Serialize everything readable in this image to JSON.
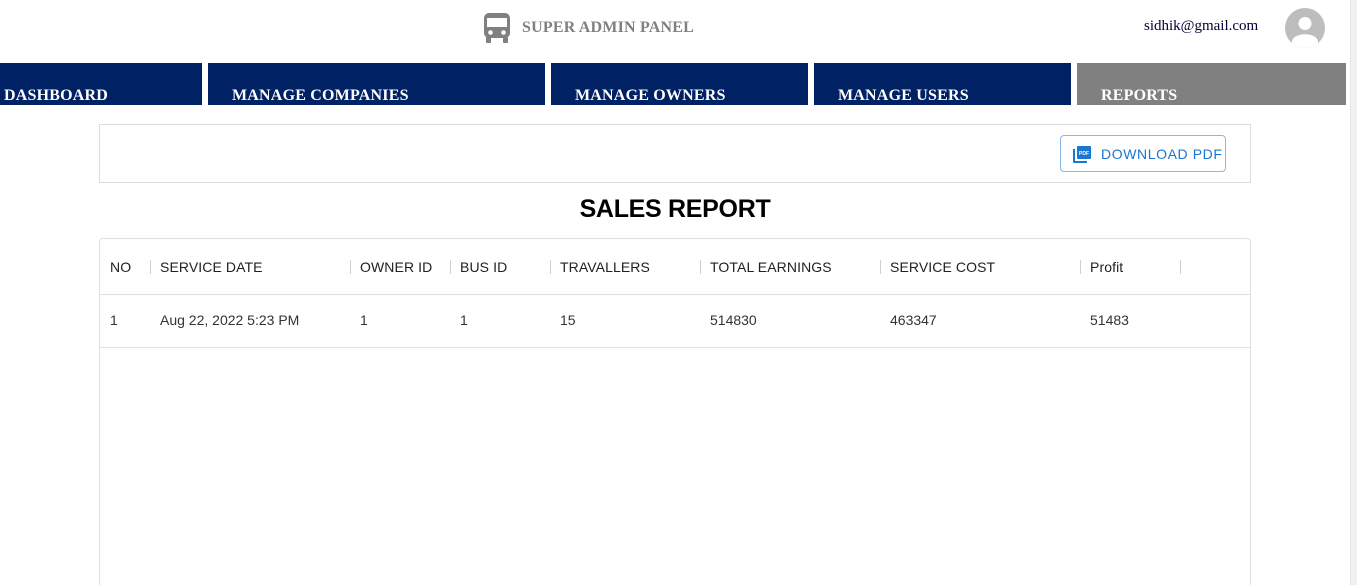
{
  "header": {
    "brand_icon": "bus-icon",
    "title": "SUPER ADMIN PANEL",
    "user_email": "sidhik@gmail.com",
    "avatar_icon": "account-circle-icon"
  },
  "nav": {
    "dashboard": "DASHBOARD",
    "companies": "MANAGE COMPANIES",
    "owners": "MANAGE OWNERS",
    "users": "MANAGE USERS",
    "reports": "REPORTS",
    "active": "REPORTS",
    "colors": {
      "nav_bg": "#002164",
      "active_bg": "#808080"
    }
  },
  "toolbar": {
    "download_label": "DOWNLOAD PDF",
    "download_icon": "picture-as-pdf-icon",
    "accent": "#1976d2"
  },
  "report": {
    "title": "SALES REPORT"
  },
  "table": {
    "columns": [
      "NO",
      "SERVICE DATE",
      "OWNER ID",
      "BUS ID",
      "TRAVALLERS",
      "TOTAL EARNINGS",
      "SERVICE COST",
      "Profit"
    ],
    "rows": [
      [
        "1",
        "Aug 22, 2022 5:23 PM",
        "1",
        "1",
        "15",
        "514830",
        "463347",
        "51483"
      ]
    ]
  }
}
